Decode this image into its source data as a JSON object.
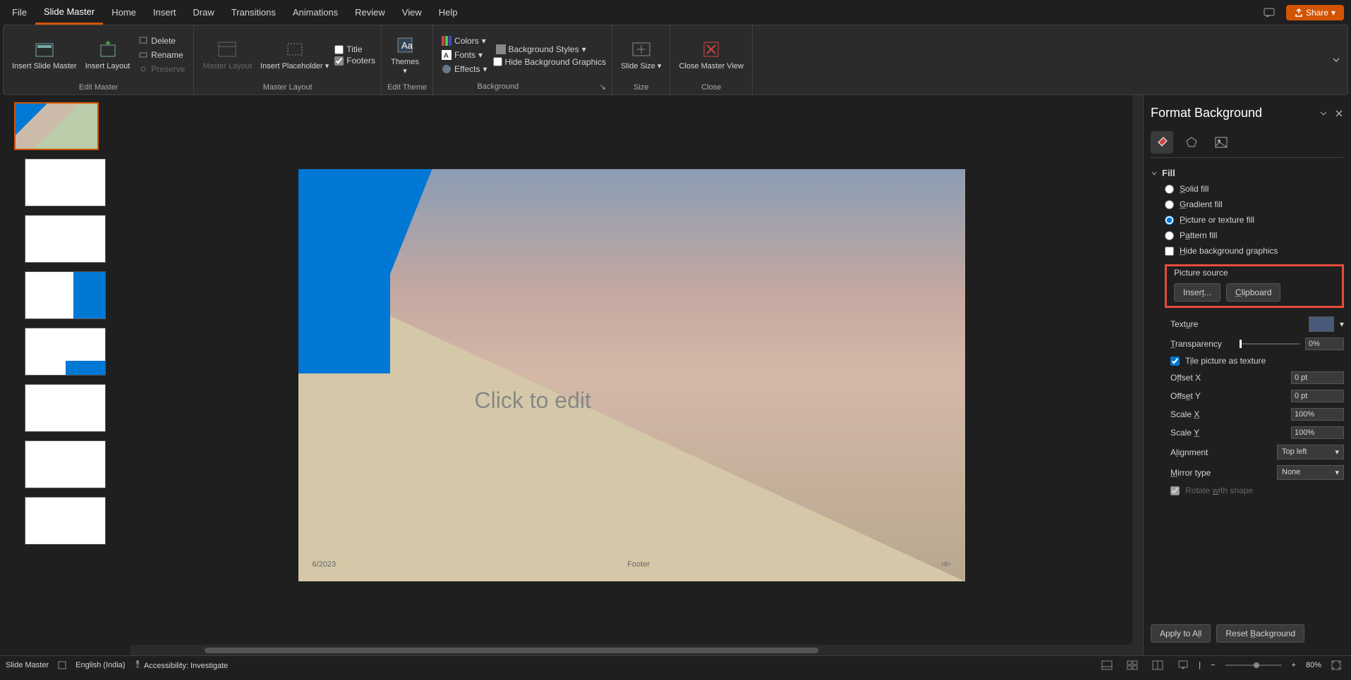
{
  "tabs": {
    "file": "File",
    "slide_master": "Slide Master",
    "home": "Home",
    "insert": "Insert",
    "draw": "Draw",
    "transitions": "Transitions",
    "animations": "Animations",
    "review": "Review",
    "view": "View",
    "help": "Help"
  },
  "titlebar": {
    "share": "Share"
  },
  "ribbon": {
    "insert_slide_master": "Insert Slide Master",
    "insert_layout": "Insert Layout",
    "delete": "Delete",
    "rename": "Rename",
    "preserve": "Preserve",
    "edit_master_label": "Edit Master",
    "master_layout": "Master Layout",
    "insert_placeholder": "Insert Placeholder",
    "title": "Title",
    "footers": "Footers",
    "master_layout_label": "Master Layout",
    "themes": "Themes",
    "edit_theme_label": "Edit Theme",
    "colors": "Colors",
    "fonts": "Fonts",
    "effects": "Effects",
    "background_styles": "Background Styles",
    "hide_bg_graphics": "Hide Background Graphics",
    "background_label": "Background",
    "slide_size": "Slide Size",
    "size_label": "Size",
    "close_master_view": "Close Master View",
    "close_label": "Close"
  },
  "slide": {
    "title_placeholder": "Click to edit",
    "date": "6/2023",
    "footer": "Footer",
    "page_num": "‹#›"
  },
  "format": {
    "title": "Format Background",
    "fill_header": "Fill",
    "solid_fill": "Solid fill",
    "gradient_fill": "Gradient fill",
    "picture_texture_fill": "Picture or texture fill",
    "pattern_fill": "Pattern fill",
    "hide_bg_graphics": "Hide background graphics",
    "picture_source": "Picture source",
    "insert_btn": "Insert...",
    "clipboard_btn": "Clipboard",
    "texture": "Texture",
    "transparency": "Transparency",
    "transparency_value": "0%",
    "tile_picture": "Tile picture as texture",
    "offset_x": "Offset X",
    "offset_x_value": "0 pt",
    "offset_y": "Offset Y",
    "offset_y_value": "0 pt",
    "scale_x": "Scale X",
    "scale_x_value": "100%",
    "scale_y": "Scale Y",
    "scale_y_value": "100%",
    "alignment": "Alignment",
    "alignment_value": "Top left",
    "mirror_type": "Mirror type",
    "mirror_value": "None",
    "rotate_with_shape": "Rotate with shape",
    "apply_to_all": "Apply to All",
    "reset_background": "Reset Background"
  },
  "statusbar": {
    "slide_master": "Slide Master",
    "language": "English (India)",
    "accessibility": "Accessibility: Investigate",
    "zoom": "80%"
  }
}
